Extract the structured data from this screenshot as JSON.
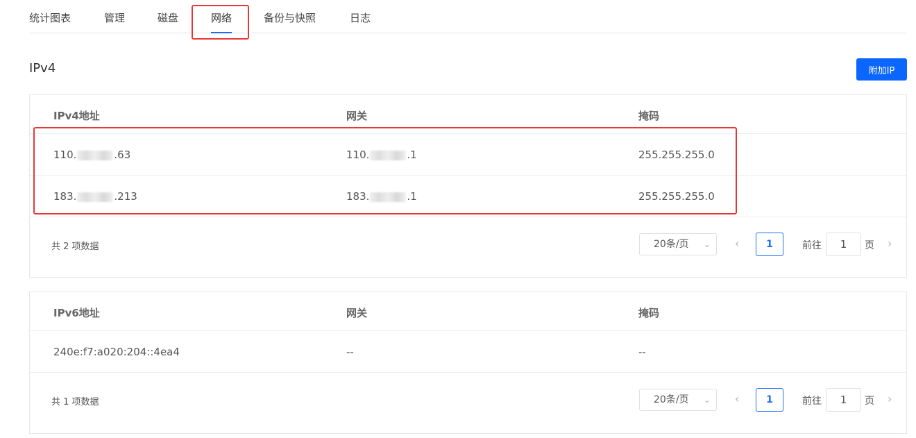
{
  "tabs": [
    {
      "label": "统计图表"
    },
    {
      "label": "管理"
    },
    {
      "label": "磁盘"
    },
    {
      "label": "网络"
    },
    {
      "label": "备份与快照"
    },
    {
      "label": "日志"
    }
  ],
  "section": {
    "title": "IPv4",
    "add_button": "附加IP"
  },
  "ipv4_table": {
    "headers": [
      "IPv4地址",
      "网关",
      "掩码"
    ],
    "rows": [
      {
        "address_prefix": "110.",
        "address_suffix": ".63",
        "gateway_prefix": "110.",
        "gateway_suffix": ".1",
        "mask": "255.255.255.0"
      },
      {
        "address_prefix": "183.",
        "address_suffix": ".213",
        "gateway_prefix": "183.",
        "gateway_suffix": ".1",
        "mask": "255.255.255.0"
      }
    ],
    "pager": {
      "total": "共 2 项数据",
      "page_size": "20条/页",
      "current_page": "1",
      "goto_label": "前往",
      "goto_value": "1",
      "goto_unit": "页"
    }
  },
  "ipv6_table": {
    "headers": [
      "IPv6地址",
      "网关",
      "掩码"
    ],
    "rows": [
      {
        "address": "240e:f7:a020:204::4ea4",
        "gateway": "--",
        "mask": "--"
      }
    ],
    "pager": {
      "total": "共 1 项数据",
      "page_size": "20条/页",
      "current_page": "1",
      "goto_label": "前往",
      "goto_value": "1",
      "goto_unit": "页"
    }
  },
  "colors": {
    "accent": "#1a6ff0",
    "primary_button": "#0a66ff",
    "highlight": "#e53935"
  }
}
